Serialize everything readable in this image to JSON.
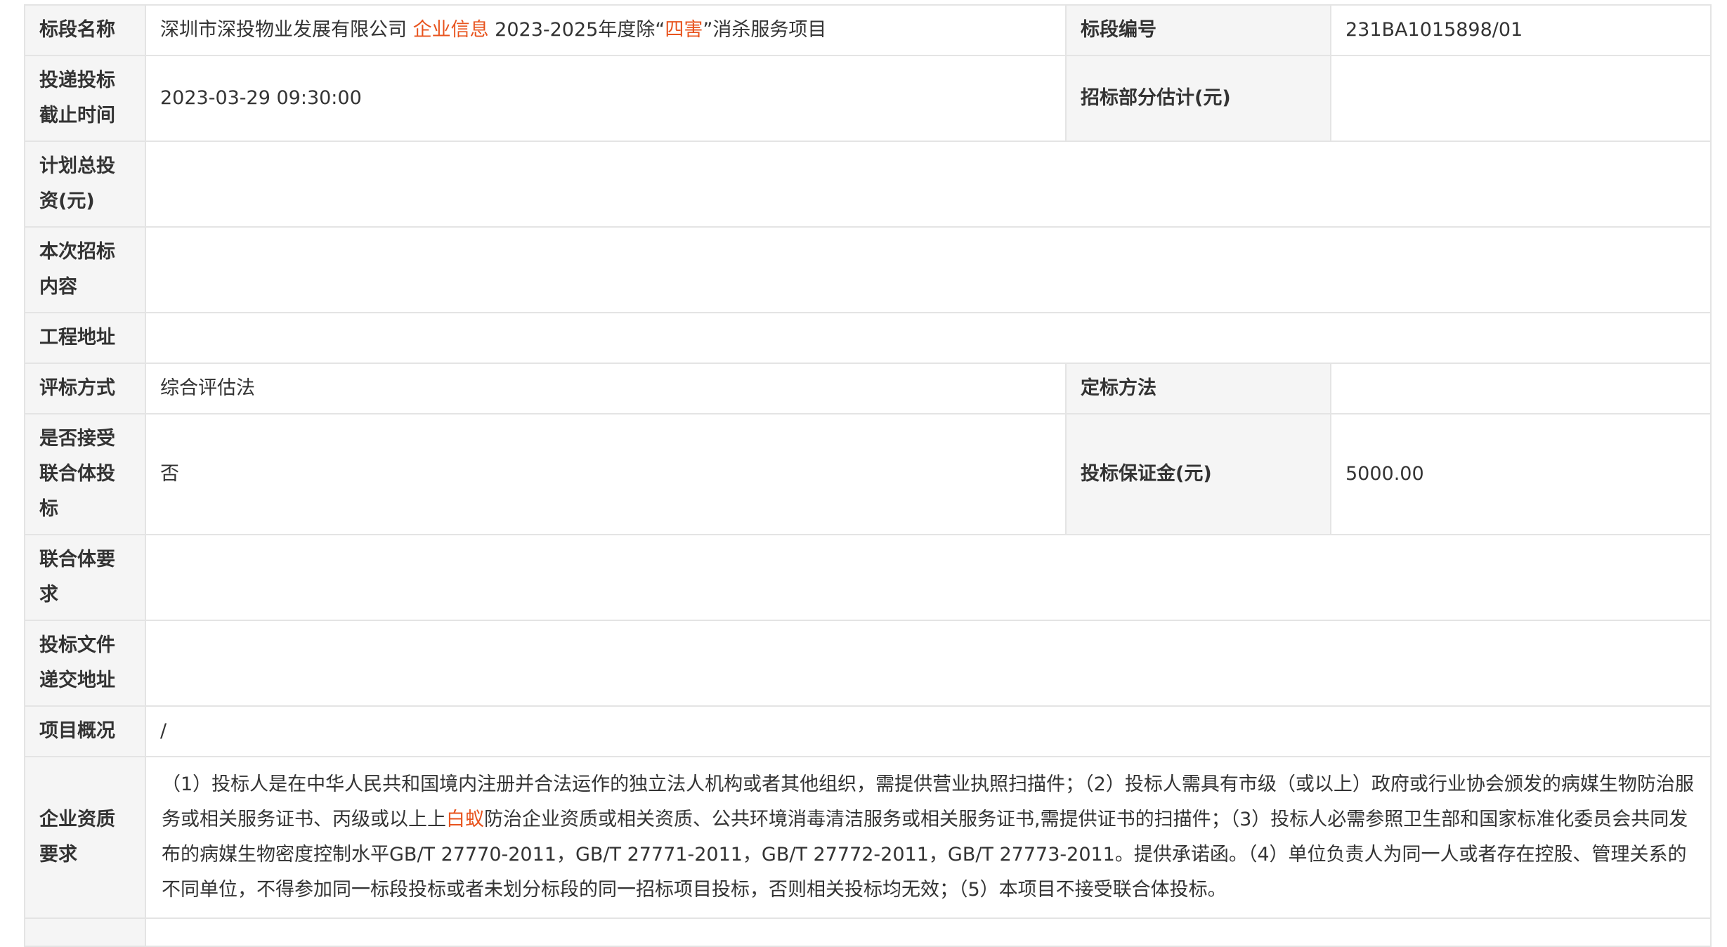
{
  "accent_color": "#e8541e",
  "rows": {
    "name": {
      "label": "标段名称",
      "value_prefix": "深圳市深投物业发展有限公司 ",
      "value_hl1": "企业信息",
      "value_mid": " 2023-2025年度除“",
      "value_hl2": "四害",
      "value_suffix": "”消杀服务项目",
      "label2": "标段编号",
      "value2": "231BA1015898/01"
    },
    "deadline": {
      "label": "投递投标截止时间",
      "value": "2023-03-29 09:30:00",
      "label2": "招标部分估计(元)",
      "value2": ""
    },
    "total_investment": {
      "label": "计划总投资(元)",
      "value": ""
    },
    "content": {
      "label": "本次招标内容",
      "value": ""
    },
    "address": {
      "label": "工程地址",
      "value": ""
    },
    "evaluation": {
      "label": "评标方式",
      "value": "综合评估法",
      "label2": "定标方法",
      "value2": ""
    },
    "consortium_accept": {
      "label": "是否接受联合体投标",
      "value": "否",
      "label2": "投标保证金(元)",
      "value2": "5000.00"
    },
    "consortium_req": {
      "label": "联合体要求",
      "value": ""
    },
    "submit_address": {
      "label": "投标文件递交地址",
      "value": ""
    },
    "overview": {
      "label": "项目概况",
      "value": "/"
    },
    "qualification": {
      "label": "企业资质要求",
      "value_part1": "（1）投标人是在中华人民共和国境内注册并合法运作的独立法人机构或者其他组织，需提供营业执照扫描件；（2）投标人需具有市级（或以上）政府或行业协会颁发的病媒生物防治服务或相关服务证书、丙级或以上上",
      "value_hl": "白蚁",
      "value_part2": "防治企业资质或相关资质、公共环境消毒清洁服务或相关服务证书,需提供证书的扫描件；（3）投标人必需参照卫生部和国家标准化委员会共同发布的病媒生物密度控制水平GB/T 27770-2011，GB/T 27771-2011，GB/T 27772-2011，GB/T 27773-2011。提供承诺函。（4）单位负责人为同一人或者存在控股、管理关系的不同单位，不得参加同一标段投标或者未划分标段的同一招标项目投标，否则相关投标均无效；（5）本项目不接受联合体投标。"
    }
  }
}
